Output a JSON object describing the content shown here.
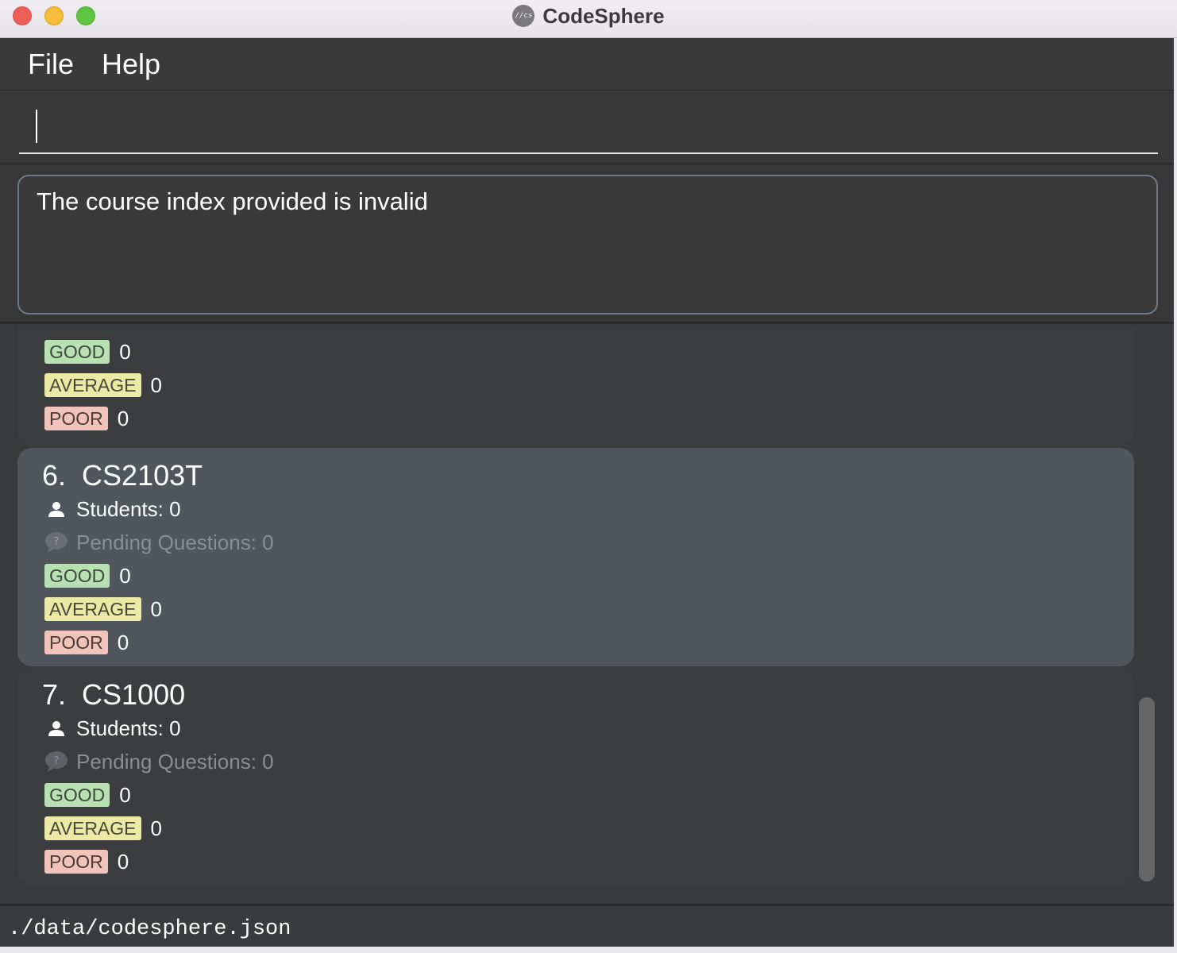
{
  "window": {
    "title": "CodeSphere",
    "logo_text": "//cs"
  },
  "menu": {
    "file": "File",
    "help": "Help"
  },
  "command": {
    "value": ""
  },
  "result": {
    "message": "The course index provided is invalid"
  },
  "courses": [
    {
      "partial": true,
      "good_label": "GOOD",
      "good": "0",
      "average_label": "AVERAGE",
      "average": "0",
      "poor_label": "POOR",
      "poor": "0"
    },
    {
      "index": "6.",
      "code": "CS2103T",
      "students": "Students: 0",
      "pending": "Pending Questions: 0",
      "good_label": "GOOD",
      "good": "0",
      "average_label": "AVERAGE",
      "average": "0",
      "poor_label": "POOR",
      "poor": "0",
      "selected": true
    },
    {
      "index": "7.",
      "code": "CS1000",
      "students": "Students: 0",
      "pending": "Pending Questions: 0",
      "good_label": "GOOD",
      "good": "0",
      "average_label": "AVERAGE",
      "average": "0",
      "poor_label": "POOR",
      "poor": "0",
      "selected": false
    }
  ],
  "status": {
    "path": "./data/codesphere.json"
  },
  "icons": {
    "student": "person-icon",
    "pending": "question-bubble-icon"
  },
  "colors": {
    "good": "#b8e0b3",
    "average": "#ece9a6",
    "poor": "#f0c4bb",
    "selected_card": "#50565b"
  }
}
